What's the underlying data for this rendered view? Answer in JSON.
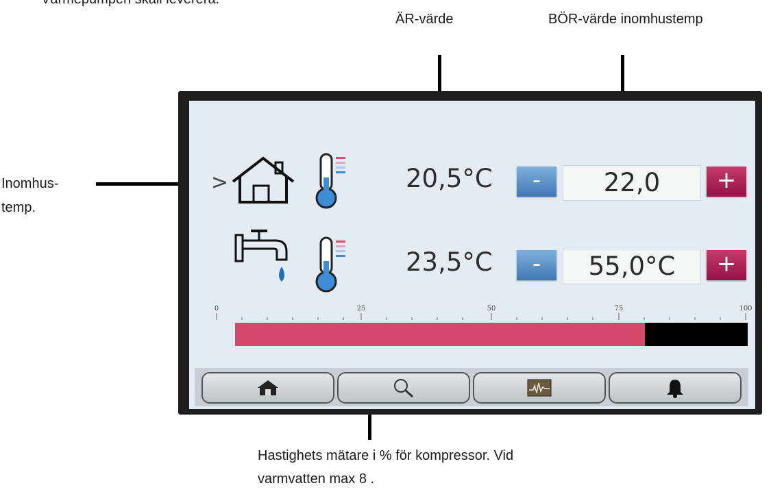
{
  "annotations": {
    "top_left_fragment": "Värmepumpen skall leverera.",
    "ar_value_label": "ÄR-värde",
    "bor_value_label": "BÖR-värde inomhustemp",
    "indoor_temp_label_line1": "Inomhus-",
    "indoor_temp_label_line2": "temp.",
    "gauge_note_line1": "Hastighets mätare i % för kompressor. Vid",
    "gauge_note_line2": "varmvatten max  8 ."
  },
  "screen": {
    "selection_marker": ">",
    "rows": [
      {
        "icon": "house-icon",
        "sensor_icon": "thermometer-icon",
        "actual_value": "20,5°C",
        "minus_label": "-",
        "setpoint_value": "22,0",
        "plus_label": "+"
      },
      {
        "icon": "water-tap-icon",
        "sensor_icon": "thermometer-icon",
        "actual_value": "23,5°C",
        "minus_label": "-",
        "setpoint_value": "55,0°C",
        "plus_label": "+"
      }
    ],
    "gauge": {
      "ticks": [
        "0",
        "25",
        "50",
        "75",
        "100"
      ],
      "value_percent": 80,
      "fill_color": "#d44a6d"
    },
    "nav": [
      {
        "icon": "home-icon"
      },
      {
        "icon": "search-icon"
      },
      {
        "icon": "graph-icon"
      },
      {
        "icon": "bell-icon"
      }
    ]
  },
  "colors": {
    "minus_button": "#4a84c0",
    "plus_button": "#a3174c",
    "screen_bg": "#e3ecf2"
  }
}
